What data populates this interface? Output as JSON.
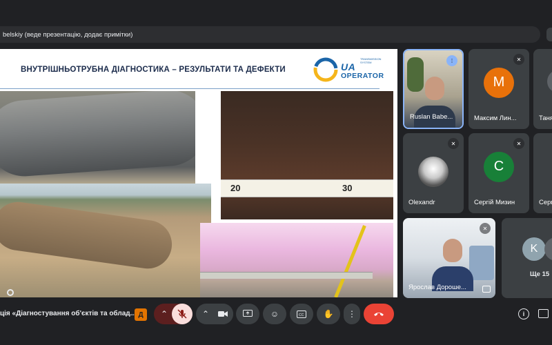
{
  "presenting_bar": {
    "text": "belskiy (веде презентацію, додає примітки)"
  },
  "slide": {
    "title": "ВНУТРІШНЬОТРУБНА ДІАГНОСТИКА – РЕЗУЛЬТАТИ ТА ДЕФЕКТИ",
    "logo_word": "UA",
    "logo_sub": "OPERATOR",
    "logo_tiny": "TRANSMISSION SYSTEM",
    "ruler_labels": [
      "20",
      "30"
    ]
  },
  "participants": [
    {
      "name": "Ruslan Babe...",
      "active": true,
      "video": true
    },
    {
      "name": "Максим Лин...",
      "initial": "М",
      "color": "#e8710a"
    },
    {
      "name": "Таня",
      "initial": "",
      "color": "#3c4043"
    },
    {
      "name": "Olexandr",
      "video": true
    },
    {
      "name": "Сергій Мизин",
      "initial": "С",
      "color": "#188038"
    },
    {
      "name": "Серг",
      "initial": "",
      "color": "#3c4043"
    },
    {
      "name": "Ярослав Дороше...",
      "video": true
    }
  ],
  "more_tile": {
    "initial": "K",
    "label": "Ще 15"
  },
  "bottom_bar": {
    "meeting_title": "ція «Діагностування об'єктів та облад...",
    "icons": [
      "presentation-icon",
      "chevron-up-icon",
      "mic-off-icon",
      "chevron-up-icon",
      "camera-icon",
      "present-screen-icon",
      "emoji-icon",
      "captions-icon",
      "raise-hand-icon",
      "more-options-icon",
      "end-call-icon",
      "info-icon",
      "chat-icon"
    ]
  },
  "colors": {
    "background": "#202124",
    "accent": "#8ab4f8",
    "end_call": "#ea4335"
  }
}
